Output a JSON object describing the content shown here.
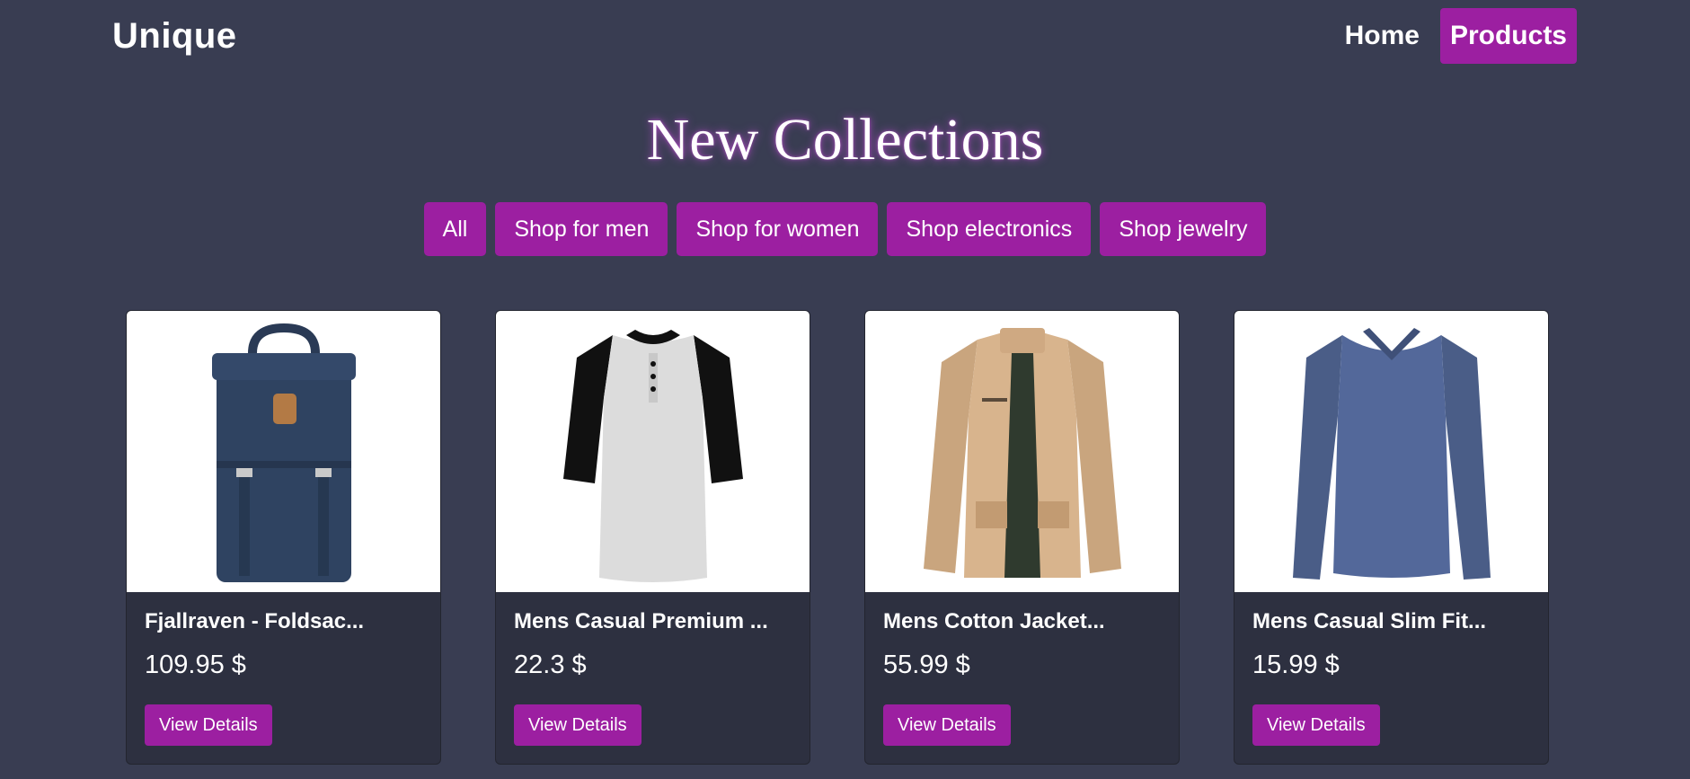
{
  "navbar": {
    "brand": "Unique",
    "links": [
      {
        "label": "Home",
        "active": false
      },
      {
        "label": "Products",
        "active": true
      }
    ]
  },
  "heading": "New Collections",
  "filters": [
    "All",
    "Shop for men",
    "Shop for women",
    "Shop electronics",
    "Shop jewelry"
  ],
  "products": [
    {
      "title": "Fjallraven - Foldsac...",
      "price": "109.95 $",
      "button": "View Details",
      "icon": "backpack-image"
    },
    {
      "title": "Mens Casual Premium ...",
      "price": "22.3 $",
      "button": "View Details",
      "icon": "raglan-tshirt-image"
    },
    {
      "title": "Mens Cotton Jacket...",
      "price": "55.99 $",
      "button": "View Details",
      "icon": "cotton-jacket-image"
    },
    {
      "title": "Mens Casual Slim Fit...",
      "price": "15.99 $",
      "button": "View Details",
      "icon": "long-sleeve-shirt-image"
    }
  ],
  "colors": {
    "background": "#393d52",
    "accent": "#9c1fa1",
    "card": "#2d3040"
  }
}
